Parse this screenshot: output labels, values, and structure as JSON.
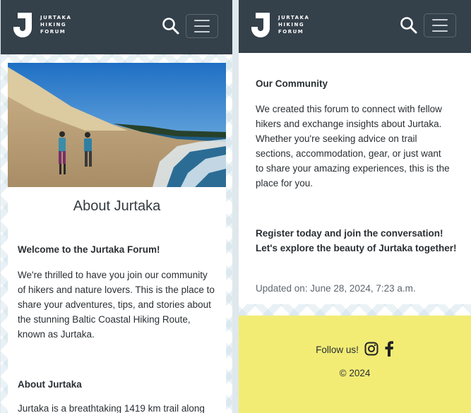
{
  "brand": {
    "line1": "JURTAKA",
    "line2": "HIKING",
    "line3": "FORUM"
  },
  "left": {
    "title": "About Jurtaka",
    "welcome_heading": "Welcome to the Jurtaka Forum!",
    "welcome_lines": [
      "We're thrilled to have you join our community",
      "of hikers and nature lovers. This is the place to",
      "share your adventures, tips, and stories about",
      "the stunning Baltic Coastal Hiking Route,",
      "known as Jurtaka."
    ],
    "about_heading": "About Jurtaka",
    "about_first_line": "Jurtaka is a breathtaking 1419 km trail along"
  },
  "right": {
    "community_heading": "Our Community",
    "community_lines": [
      "We created this forum to connect with fellow",
      "hikers and exchange insights about Jurtaka.",
      "Whether you're seeking advice on trail",
      "sections, accommodation, gear, or just want",
      "to share your amazing experiences, this is the",
      "place for you."
    ],
    "cta_line1": "Register today and join the conversation!",
    "cta_line2": "Let's explore the beauty of Jurtaka together!",
    "updated": "Updated on: June 28, 2024, 7:23 a.m."
  },
  "footer": {
    "follow": "Follow us!",
    "copyright": "© 2024"
  },
  "colors": {
    "navbar": "#34404a",
    "footer": "#f2ec75"
  },
  "icons": [
    "search-icon",
    "hamburger-menu-icon",
    "instagram-icon",
    "facebook-icon"
  ]
}
